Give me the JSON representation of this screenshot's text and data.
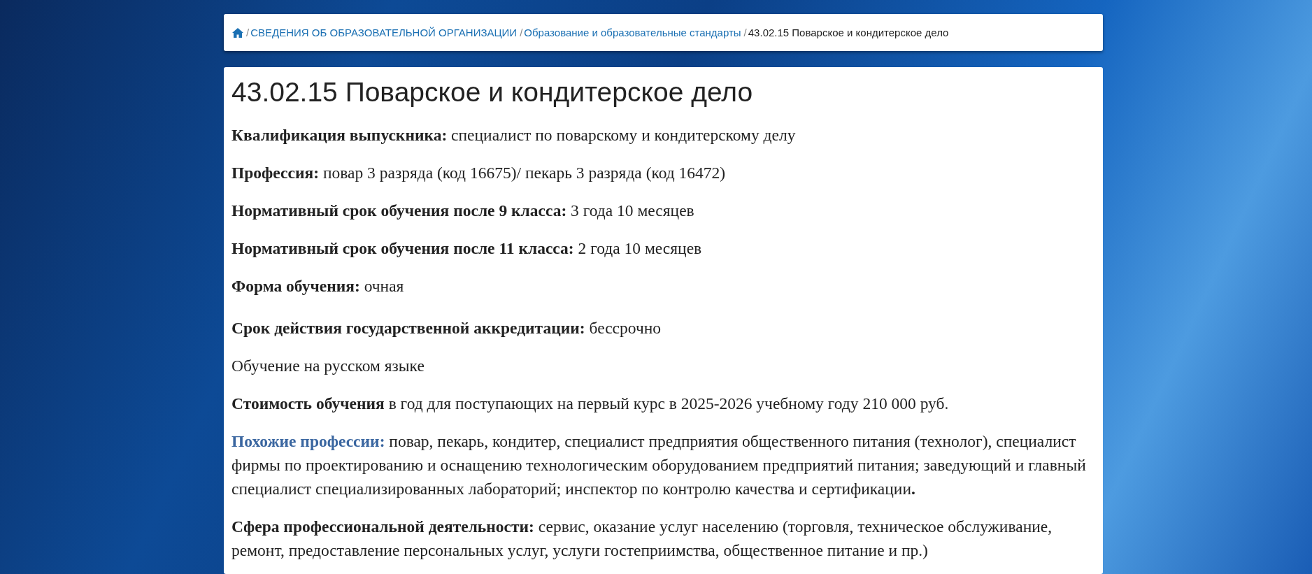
{
  "breadcrumb": [
    {
      "kind": "home"
    },
    {
      "kind": "link",
      "separator": "/",
      "label": "СВЕДЕНИЯ ОБ ОБРАЗОВАТЕЛЬНОЙ ОРГАНИЗАЦИИ"
    },
    {
      "kind": "link",
      "separator": "/",
      "label": "Образование и образовательные стандарты"
    },
    {
      "kind": "current",
      "separator": "/",
      "label": "43.02.15 Поварское и кондитерское дело"
    }
  ],
  "page_title": "43.02.15 Поварское и кондитерское дело",
  "paragraphs": [
    {
      "kind": "plain",
      "label": "Квалификация выпускника:",
      "text": "специалист по поварскому и кондитерскому делу"
    },
    {
      "kind": "plain",
      "label": "Профессия:",
      "text": "повар 3 разряда (код 16675)/ пекарь 3 разряда (код 16472)"
    },
    {
      "kind": "plain",
      "label": "Нормативный срок обучения после 9 класса:",
      "text": "3 года 10 месяцев"
    },
    {
      "kind": "plain",
      "label": "Нормативный срок обучения после 11 класса:",
      "text": "2 года 10 месяцев"
    },
    {
      "kind": "plain",
      "label": "Форма обучения:",
      "text": "очная"
    },
    {
      "kind": "plain",
      "label": "Срок действия государственной аккредитации:",
      "text": "бессрочно"
    },
    {
      "kind": "plain",
      "text": "Обучение на русском языке"
    },
    {
      "kind": "plain",
      "label": "Стоимость обучения",
      "text": "в год для поступающих на первый курс в 2025-2026 учебному году 210 000 руб."
    },
    {
      "kind": "accent",
      "label": "Похожие профессии:",
      "text": "повар, пекарь, кондитер, специалист предприятия общественного питания (технолог), специалист фирмы по проектированию и оснащению технологическим оборудованием предприятий питания; заведующий и главный специалист специализированных лабораторий; инспектор по контролю качества и сертификации**.**"
    },
    {
      "kind": "plain",
      "label": "Сфера профессиональной деятельности:",
      "text": "сервис, оказание услуг населению (торговля, техническое обслуживание, ремонт, предоставление персональных услуг, услуги гостеприимства, общественное питание и пр.)"
    }
  ]
}
